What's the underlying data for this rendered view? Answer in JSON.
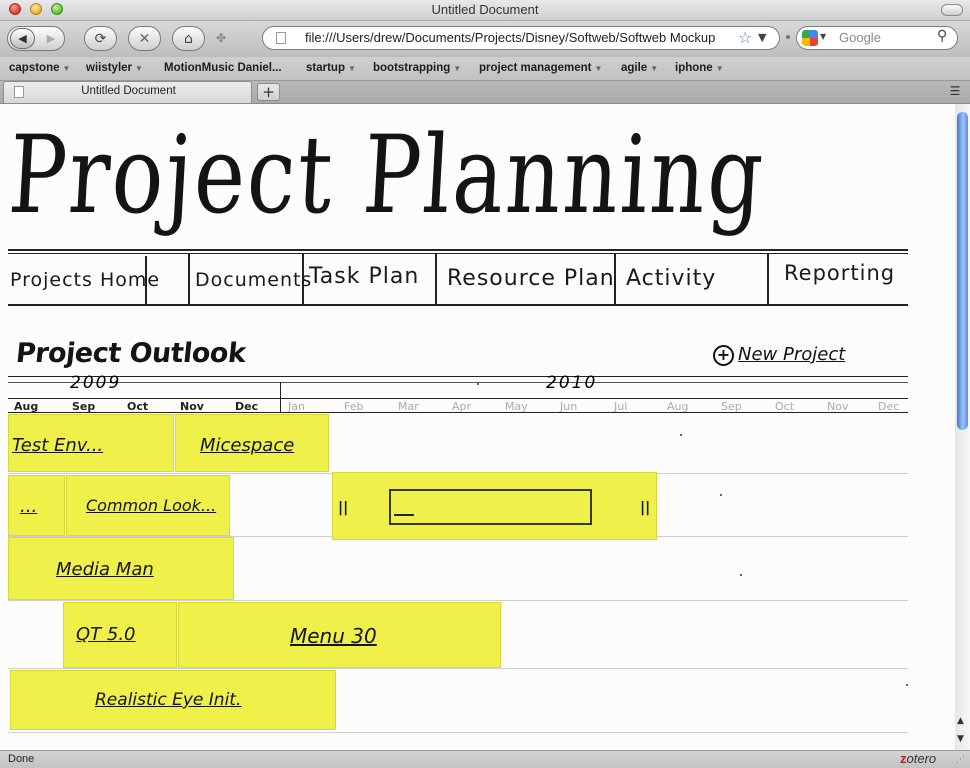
{
  "window": {
    "title": "Untitled Document"
  },
  "toolbar": {
    "url": "file:///Users/drew/Documents/Projects/Disney/Softweb/Softweb Mockup",
    "search_placeholder": "Google"
  },
  "bookmarks": [
    "capstone",
    "wiistyler",
    "MotionMusic Daniel...",
    "startup",
    "bootstrapping",
    "project management",
    "agile",
    "iphone"
  ],
  "tab": {
    "label": "Untitled Document"
  },
  "status": {
    "text": "Done",
    "zotero": "otero",
    "zotero_z": "z"
  },
  "page": {
    "title": "Project Planning",
    "nav": [
      "Projects Home",
      "Documents",
      "Task Plan",
      "Resource Plan",
      "Activity",
      "Reporting"
    ],
    "outlook_title": "Project Outlook",
    "new_project": "New Project",
    "years": [
      "2009",
      "2010"
    ],
    "months": [
      "Aug",
      "Sep",
      "Oct",
      "Nov",
      "Dec",
      "Jan",
      "Feb",
      "Mar",
      "Apr",
      "May",
      "Jun",
      "Jul",
      "Aug",
      "Sep",
      "Oct",
      "Nov",
      "Dec"
    ],
    "projects": [
      "Test Env...",
      "Micespace",
      "...",
      "Common Look...",
      "Media Man",
      "QT 5.0",
      "Menu 30",
      "Realistic Eye Init."
    ],
    "slider_handle_left": "||",
    "slider_handle_right": "||"
  },
  "colors": {
    "sticky": "#f0f04a",
    "ink": "#141414"
  }
}
